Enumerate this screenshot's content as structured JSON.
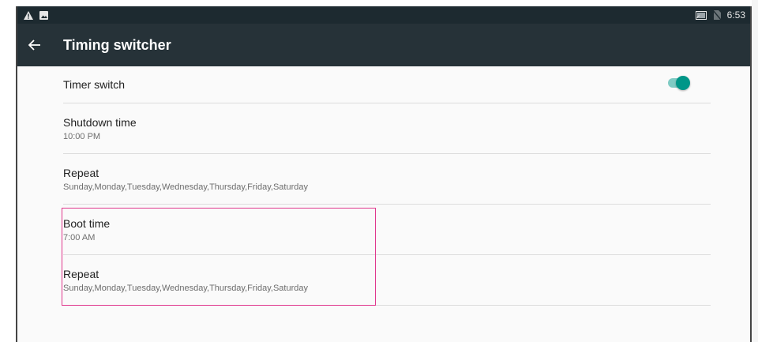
{
  "status_bar": {
    "time": "6:53",
    "left_icons": [
      "warning-icon",
      "image-icon"
    ],
    "right_icons": [
      "cast-icon",
      "no-sim-icon"
    ]
  },
  "app_bar": {
    "title": "Timing switcher",
    "back_icon": "arrow-back-icon"
  },
  "settings": {
    "timer_switch": {
      "label": "Timer switch",
      "enabled": true
    },
    "shutdown_time": {
      "label": "Shutdown time",
      "value": "10:00 PM"
    },
    "shutdown_repeat": {
      "label": "Repeat",
      "value": "Sunday,Monday,Tuesday,Wednesday,Thursday,Friday,Saturday"
    },
    "boot_time": {
      "label": "Boot time",
      "value": "7:00 AM"
    },
    "boot_repeat": {
      "label": "Repeat",
      "value": "Sunday,Monday,Tuesday,Wednesday,Thursday,Friday,Saturday"
    }
  },
  "colors": {
    "app_bar": "#263238",
    "status_bar": "#1d2a30",
    "switch_on": "#009688",
    "highlight": "#e0368c"
  }
}
